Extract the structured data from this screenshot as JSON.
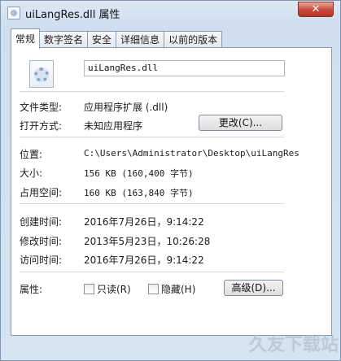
{
  "window": {
    "title": "uiLangRes.dll 属性",
    "close_label": "✕"
  },
  "tabs": [
    {
      "label": "常规"
    },
    {
      "label": "数字签名"
    },
    {
      "label": "安全"
    },
    {
      "label": "详细信息"
    },
    {
      "label": "以前的版本"
    }
  ],
  "general": {
    "file_name": "uiLangRes.dll",
    "file_type_label": "文件类型:",
    "file_type_value": "应用程序扩展 (.dll)",
    "open_with_label": "打开方式:",
    "open_with_value": "未知应用程序",
    "change_button": "更改(C)...",
    "location_label": "位置:",
    "location_value": "C:\\Users\\Administrator\\Desktop\\uiLangRes",
    "size_label": "大小:",
    "size_value": "156 KB (160,400 字节)",
    "disk_size_label": "占用空间:",
    "disk_size_value": "160 KB (163,840 字节)",
    "created_label": "创建时间:",
    "created_value": "2016年7月26日，9:14:22",
    "modified_label": "修改时间:",
    "modified_value": "2013年5月23日，10:26:28",
    "accessed_label": "访问时间:",
    "accessed_value": "2016年7月26日，9:14:22",
    "attributes_label": "属性:",
    "readonly_label": "只读(R)",
    "hidden_label": "隐藏(H)",
    "advanced_button": "高级(D)..."
  },
  "watermark": "久友下载站"
}
